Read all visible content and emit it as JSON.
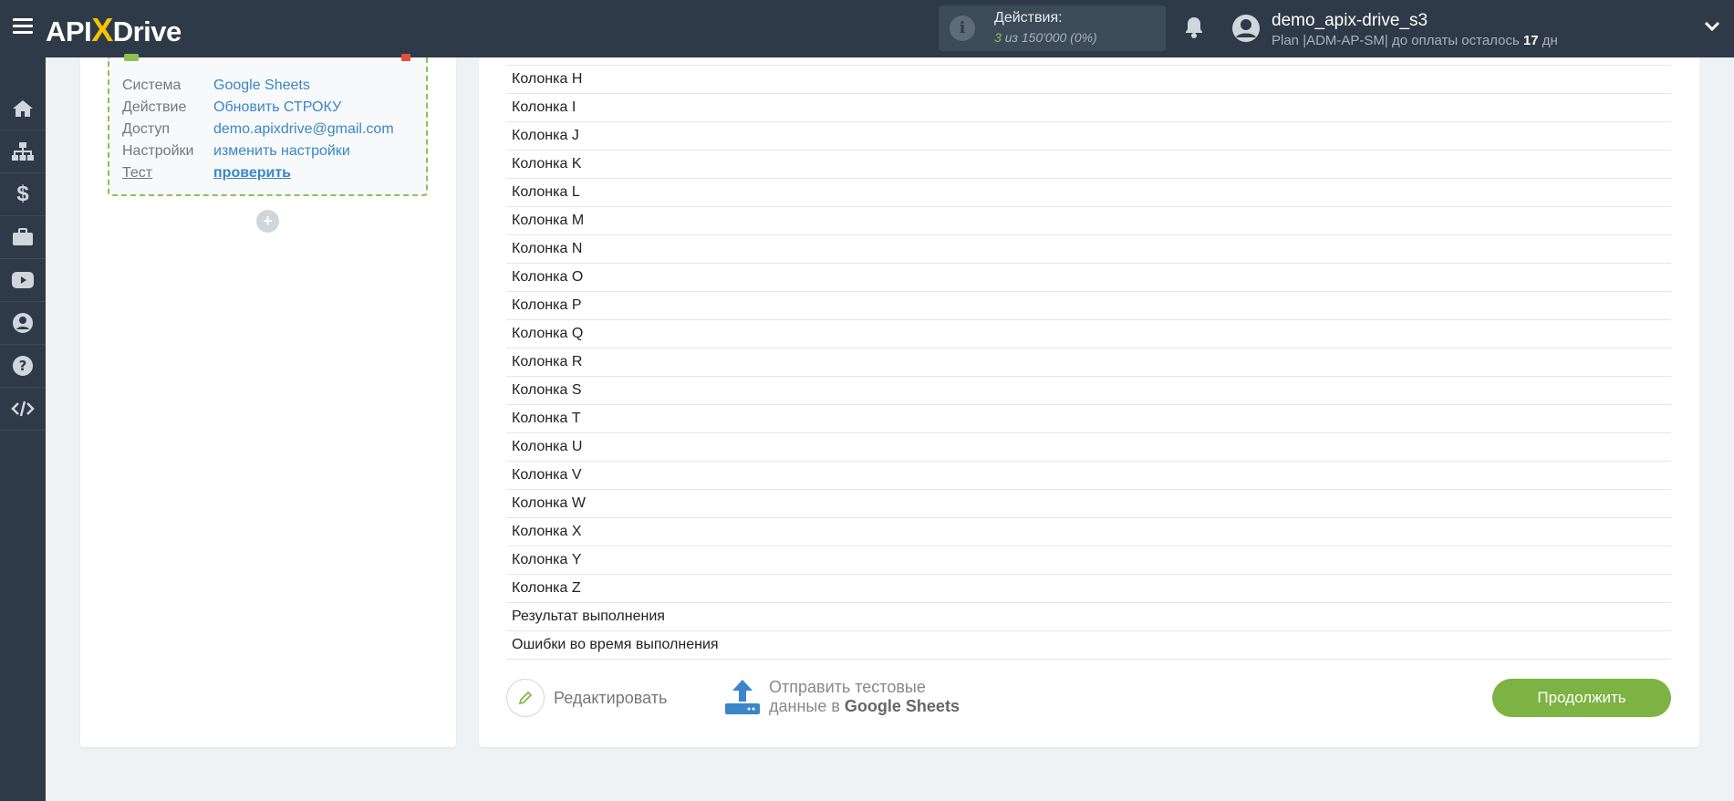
{
  "header": {
    "logo_left": "API",
    "logo_x": "X",
    "logo_right": "Drive",
    "actions_label": "Действия:",
    "actions_used": "3",
    "actions_of": "из 150'000",
    "actions_percent": "(0%)",
    "username": "demo_apix-drive_s3",
    "plan_prefix": "Plan |ADM-AP-SM| до оплаты осталось",
    "plan_days": "17",
    "plan_suffix": "дн"
  },
  "sidebar": {
    "items": [
      {
        "icon": "home-icon"
      },
      {
        "icon": "sitemap-icon"
      },
      {
        "icon": "dollar-icon"
      },
      {
        "icon": "briefcase-icon"
      },
      {
        "icon": "youtube-icon"
      },
      {
        "icon": "user-icon"
      },
      {
        "icon": "question-icon"
      },
      {
        "icon": "code-icon"
      }
    ]
  },
  "connector": {
    "rows": [
      {
        "key": "Система",
        "value": "Google Sheets"
      },
      {
        "key": "Действие",
        "value": "Обновить СТРОКУ"
      },
      {
        "key": "Доступ",
        "value": "demo.apixdrive@gmail.com"
      },
      {
        "key": "Настройки",
        "value": "изменить настройки"
      },
      {
        "key": "Тест",
        "value": "проверить"
      }
    ],
    "add_label": "+"
  },
  "columns": [
    "Колонка H",
    "Колонка I",
    "Колонка J",
    "Колонка K",
    "Колонка L",
    "Колонка M",
    "Колонка N",
    "Колонка O",
    "Колонка P",
    "Колонка Q",
    "Колонка R",
    "Колонка S",
    "Колонка T",
    "Колонка U",
    "Колонка V",
    "Колонка W",
    "Колонка X",
    "Колонка Y",
    "Колонка Z",
    "Результат выполнения",
    "Ошибки во время выполнения"
  ],
  "footer": {
    "edit_label": "Редактировать",
    "send_line1": "Отправить тестовые",
    "send_line2_prefix": "данные в",
    "send_line2_bold": "Google Sheets",
    "continue_label": "Продолжить"
  },
  "colors": {
    "topbar": "#2e3a47",
    "accent_green": "#7cb342",
    "link_blue": "#3a86c8"
  }
}
